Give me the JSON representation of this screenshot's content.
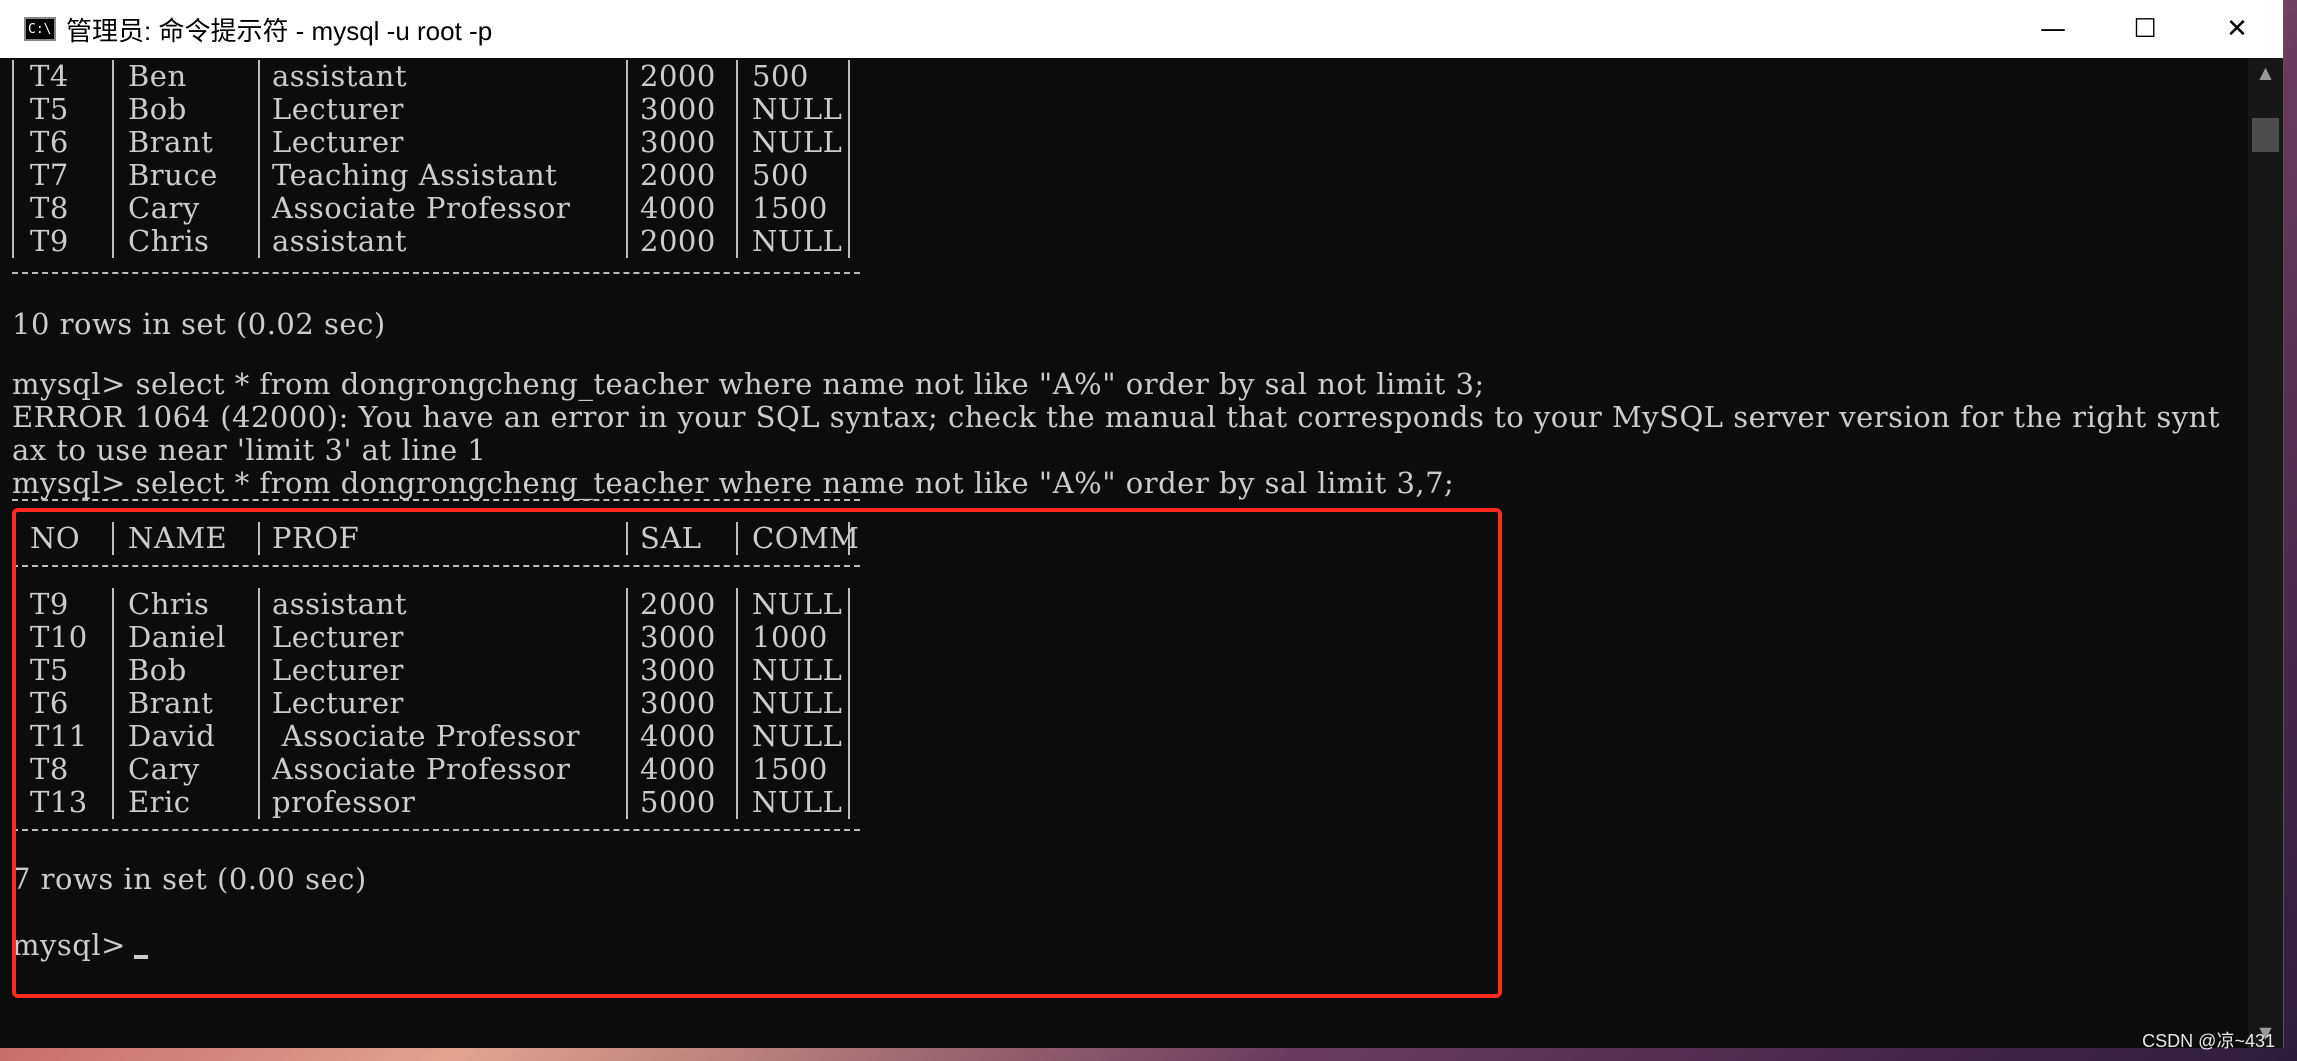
{
  "window": {
    "title": "管理员: 命令提示符 - mysql  -u root -p",
    "app_icon_label": "C:\\",
    "minimize_label": "—",
    "maximize_label": "☐",
    "close_label": "✕"
  },
  "table_columns": [
    "NO",
    "NAME",
    "PROF",
    "SAL",
    "COMM"
  ],
  "top_rows": [
    [
      "T4",
      "Ben",
      "assistant",
      "2000",
      "500"
    ],
    [
      "T5",
      "Bob",
      "Lecturer",
      "3000",
      "NULL"
    ],
    [
      "T6",
      "Brant",
      "Lecturer",
      "3000",
      "NULL"
    ],
    [
      "T7",
      "Bruce",
      "Teaching Assistant",
      "2000",
      "500"
    ],
    [
      "T8",
      "Cary",
      "Associate Professor",
      "4000",
      "1500"
    ],
    [
      "T9",
      "Chris",
      "assistant",
      "2000",
      "NULL"
    ]
  ],
  "rows_summary_1": "10 rows in set (0.02 sec)",
  "command_1": "mysql> select * from dongrongcheng_teacher where name not like \"A%\" order by sal not limit 3;",
  "error_line_1": "ERROR 1064 (42000): You have an error in your SQL syntax; check the manual that corresponds to your MySQL server version for the right synt",
  "error_line_2": "ax to use near 'limit 3' at line 1",
  "command_2": "mysql> select * from dongrongcheng_teacher where name not like \"A%\" order by sal limit 3,7;",
  "result_rows": [
    [
      "T9",
      "Chris",
      "assistant",
      "2000",
      "NULL"
    ],
    [
      "T10",
      "Daniel",
      "Lecturer",
      "3000",
      "1000"
    ],
    [
      "T5",
      "Bob",
      "Lecturer",
      "3000",
      "NULL"
    ],
    [
      "T6",
      "Brant",
      "Lecturer",
      "3000",
      "NULL"
    ],
    [
      "T11",
      "David",
      " Associate Professor",
      "4000",
      "NULL"
    ],
    [
      "T8",
      "Cary",
      "Associate Professor",
      "4000",
      "1500"
    ],
    [
      "T13",
      "Eric",
      "professor",
      "5000",
      "NULL"
    ]
  ],
  "rows_summary_2": "7 rows in set (0.00 sec)",
  "prompt": "mysql>",
  "watermark": "CSDN @凉~431",
  "colors": {
    "terminal_bg": "#0c0c0c",
    "terminal_text": "#cccccc",
    "highlight_border": "#ff2a20"
  }
}
